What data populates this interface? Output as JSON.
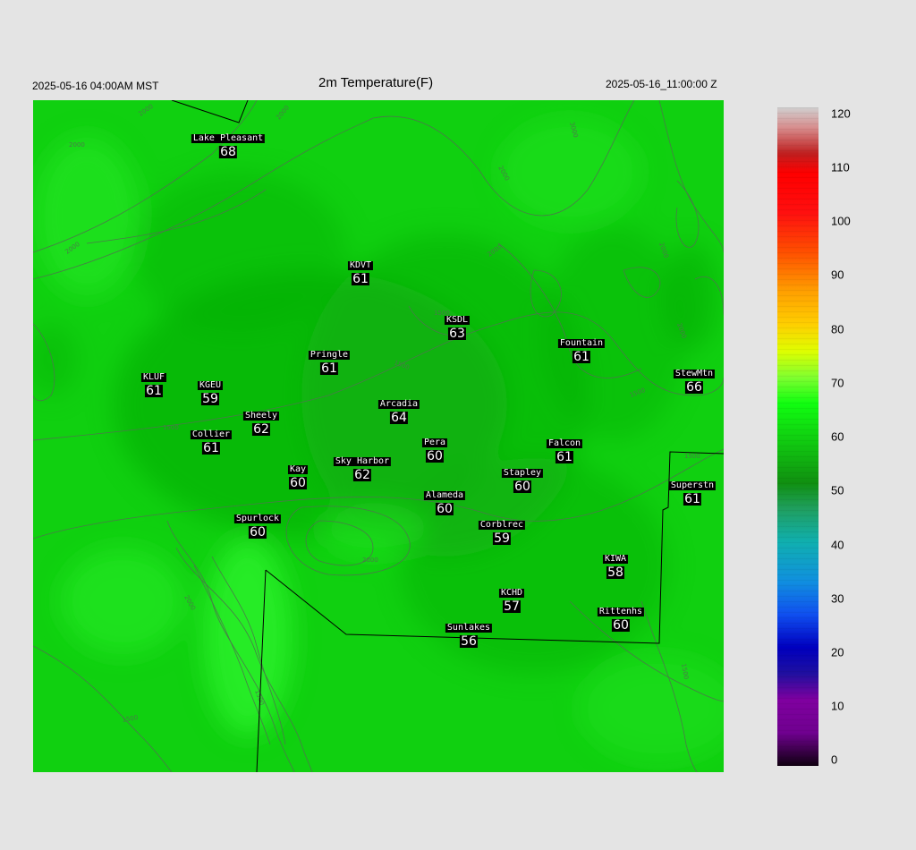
{
  "header": {
    "left": "2025-05-16 04:00AM MST",
    "title": "2m Temperature(F)",
    "right": "2025-05-16_11:00:00 Z"
  },
  "map": {
    "colors": {
      "field_base": "#10d010",
      "field_dark": "#0aa80a",
      "field_light": "#2af22a",
      "contour": "#4a7a4a",
      "boundary": "#000000"
    },
    "contour_labels": [
      "2000",
      "2000",
      "2000",
      "3000",
      "2000",
      "2000",
      "2000",
      "1500",
      "1500",
      "1500",
      "1500",
      "2000",
      "2000",
      "1500",
      "1500",
      "1500",
      "2000",
      "2000",
      "1500"
    ],
    "stations": [
      {
        "name": "Lake Pleasant",
        "value": "68"
      },
      {
        "name": "KDVT",
        "value": "61"
      },
      {
        "name": "KSDL",
        "value": "63"
      },
      {
        "name": "Fountain",
        "value": "61"
      },
      {
        "name": "StewMtn",
        "value": "66"
      },
      {
        "name": "Pringle",
        "value": "61"
      },
      {
        "name": "KLUF",
        "value": "61"
      },
      {
        "name": "KGEU",
        "value": "59"
      },
      {
        "name": "Arcadia",
        "value": "64"
      },
      {
        "name": "Sheely",
        "value": "62"
      },
      {
        "name": "Collier",
        "value": "61"
      },
      {
        "name": "Pera",
        "value": "60"
      },
      {
        "name": "Falcon",
        "value": "61"
      },
      {
        "name": "Kay",
        "value": "60"
      },
      {
        "name": "Sky Harbor",
        "value": "62"
      },
      {
        "name": "Stapley",
        "value": "60"
      },
      {
        "name": "Superstn",
        "value": "61"
      },
      {
        "name": "Alameda",
        "value": "60"
      },
      {
        "name": "Spurlock",
        "value": "60"
      },
      {
        "name": "Corblrec",
        "value": "59"
      },
      {
        "name": "KIWA",
        "value": "58"
      },
      {
        "name": "KCHD",
        "value": "57"
      },
      {
        "name": "Rittenhs",
        "value": "60"
      },
      {
        "name": "Sunlakes",
        "value": "56"
      }
    ]
  },
  "colorbar": {
    "ticks": [
      "120",
      "110",
      "100",
      "90",
      "80",
      "70",
      "60",
      "50",
      "40",
      "30",
      "20",
      "10",
      "0"
    ],
    "stops": [
      {
        "at": 0.0,
        "color": "#d0d0d0"
      },
      {
        "at": 0.03,
        "color": "#d89090"
      },
      {
        "at": 0.07,
        "color": "#c02020"
      },
      {
        "at": 0.1,
        "color": "#ff0000"
      },
      {
        "at": 0.16,
        "color": "#ff1010"
      },
      {
        "at": 0.22,
        "color": "#ff5000"
      },
      {
        "at": 0.28,
        "color": "#ffa000"
      },
      {
        "at": 0.33,
        "color": "#ffd000"
      },
      {
        "at": 0.37,
        "color": "#e0ff00"
      },
      {
        "at": 0.41,
        "color": "#80ff30"
      },
      {
        "at": 0.45,
        "color": "#10ff10"
      },
      {
        "at": 0.52,
        "color": "#10c010"
      },
      {
        "at": 0.57,
        "color": "#109010"
      },
      {
        "at": 0.61,
        "color": "#20a060"
      },
      {
        "at": 0.66,
        "color": "#10b0b0"
      },
      {
        "at": 0.72,
        "color": "#1090e0"
      },
      {
        "at": 0.77,
        "color": "#1050f0"
      },
      {
        "at": 0.82,
        "color": "#0000c0"
      },
      {
        "at": 0.86,
        "color": "#2010a0"
      },
      {
        "at": 0.9,
        "color": "#8000a0"
      },
      {
        "at": 0.95,
        "color": "#700090"
      },
      {
        "at": 1.0,
        "color": "#100010"
      }
    ]
  }
}
